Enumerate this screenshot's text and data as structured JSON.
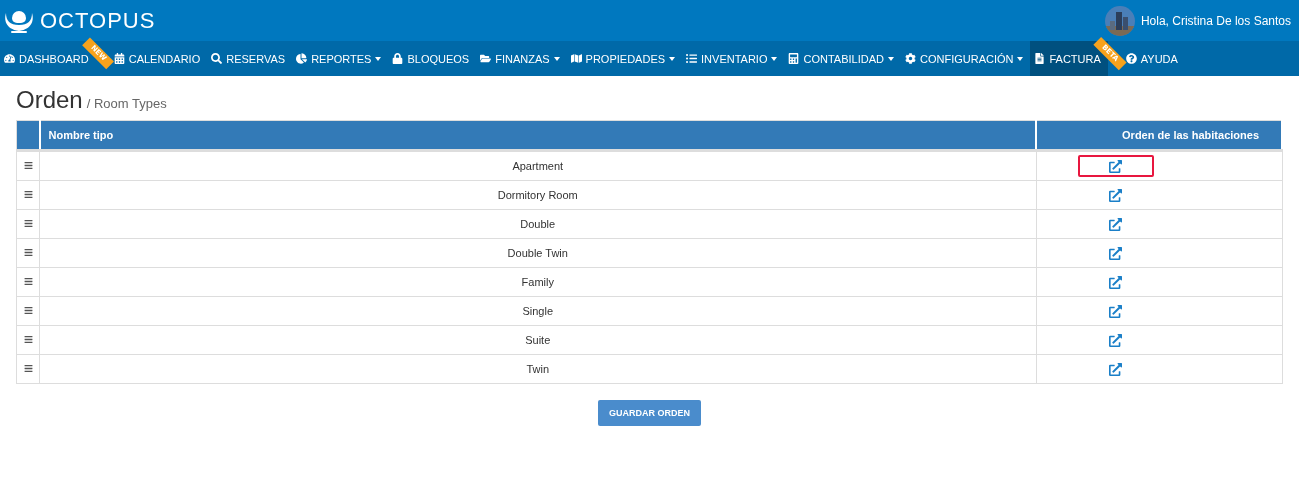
{
  "header": {
    "brand": "OCTOPUS",
    "greeting": "Hola, Cristina De los Santos"
  },
  "nav": [
    {
      "label": "DASHBOARD",
      "dropdown": false,
      "selected": false,
      "ribbon": "NEW"
    },
    {
      "label": "CALENDARIO",
      "dropdown": false,
      "selected": false
    },
    {
      "label": "RESERVAS",
      "dropdown": false,
      "selected": false
    },
    {
      "label": "REPORTES",
      "dropdown": true,
      "selected": false
    },
    {
      "label": "BLOQUEOS",
      "dropdown": false,
      "selected": false
    },
    {
      "label": "FINANZAS",
      "dropdown": true,
      "selected": false
    },
    {
      "label": "PROPIEDADES",
      "dropdown": true,
      "selected": false
    },
    {
      "label": "INVENTARIO",
      "dropdown": true,
      "selected": false
    },
    {
      "label": "CONTABILIDAD",
      "dropdown": true,
      "selected": false
    },
    {
      "label": "CONFIGURACIÓN",
      "dropdown": true,
      "selected": false
    },
    {
      "label": "FACTURA",
      "dropdown": false,
      "selected": true,
      "ribbon": "BETA"
    },
    {
      "label": "AYUDA",
      "dropdown": false,
      "selected": false
    }
  ],
  "page": {
    "title": "Orden",
    "subtitle": "/ Room Types"
  },
  "table": {
    "columns": [
      "Nombre tipo",
      "Orden de las habitaciones"
    ],
    "rows": [
      {
        "name": "Apartment",
        "highlighted": true
      },
      {
        "name": "Dormitory Room",
        "highlighted": false
      },
      {
        "name": "Double",
        "highlighted": false
      },
      {
        "name": "Double Twin",
        "highlighted": false
      },
      {
        "name": "Family",
        "highlighted": false
      },
      {
        "name": "Single",
        "highlighted": false
      },
      {
        "name": "Suite",
        "highlighted": false
      },
      {
        "name": "Twin",
        "highlighted": false
      }
    ]
  },
  "save_button": "GUARDAR ORDEN"
}
